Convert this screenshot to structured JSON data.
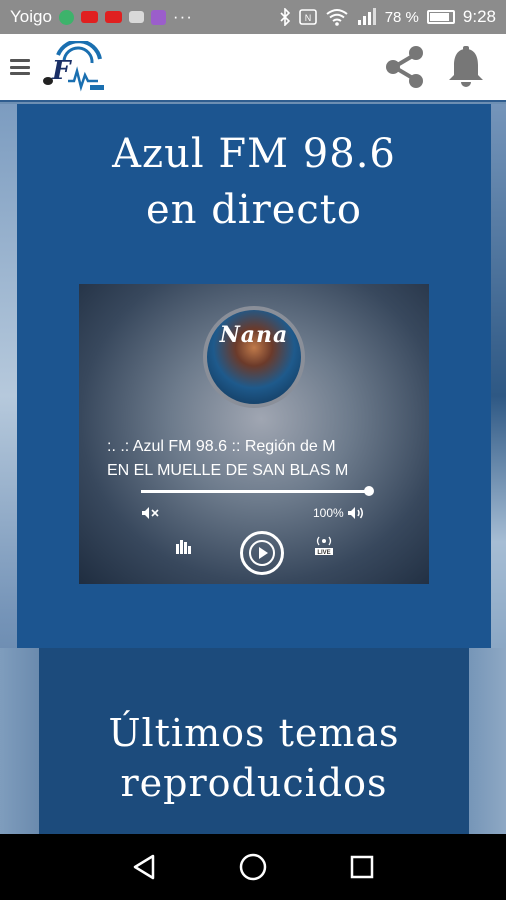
{
  "status_bar": {
    "carrier": "Yoigo",
    "dots": "···",
    "battery": "78 %",
    "time": "9:28",
    "icons": [
      "whatsapp-icon",
      "youtube-icon",
      "youtube-icon",
      "mail-icon",
      "podcast-icon",
      "bluetooth-icon",
      "nfc-icon",
      "wifi-icon",
      "signal-icon",
      "battery-icon"
    ]
  },
  "app_bar": {
    "menu_icon": "hamburger-icon",
    "logo_icon": "azul-fm-logo",
    "share_icon": "share-icon",
    "notifications_icon": "bell-icon"
  },
  "live": {
    "title_line1": "Azul FM 98.6",
    "title_line2": "en directo"
  },
  "player": {
    "cover_text": "Nana",
    "marquee_line1": ":.       .: Azul FM 98.6 :: Región de M",
    "marquee_line2": "EN EL MUELLE DE SAN BLAS        M",
    "progress_fraction": 1.0,
    "volume_percent": "100%",
    "icons": [
      "mute-icon",
      "volume-icon",
      "equalizer-icon",
      "play-icon",
      "live-icon"
    ]
  },
  "recent": {
    "title_line1": "Últimos temas",
    "title_line2": "reproducidos"
  },
  "nav_bar": {
    "icons": [
      "back-icon",
      "home-icon",
      "recents-icon"
    ]
  },
  "colors": {
    "live_card": "#1c5590",
    "recent_card": "#1c4b7c",
    "header_border": "#2f5d8f",
    "status_bar": "#8c8c8c"
  }
}
